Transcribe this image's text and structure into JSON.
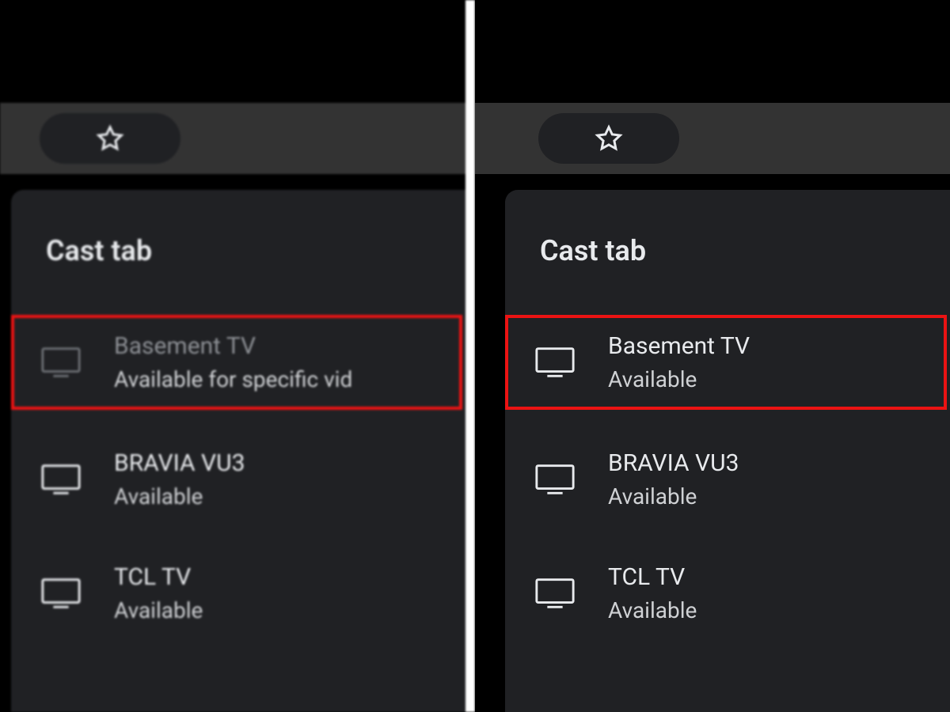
{
  "left": {
    "title": "Cast tab",
    "devices": [
      {
        "name": "Basement TV",
        "status": "Available for specific vid",
        "highlighted": true,
        "dimmed": true
      },
      {
        "name": "BRAVIA VU3",
        "status": "Available",
        "highlighted": false,
        "dimmed": false
      },
      {
        "name": "TCL TV",
        "status": "Available",
        "highlighted": false,
        "dimmed": false
      }
    ]
  },
  "right": {
    "title": "Cast tab",
    "devices": [
      {
        "name": "Basement TV",
        "status": "Available",
        "highlighted": true,
        "dimmed": false
      },
      {
        "name": "BRAVIA VU3",
        "status": "Available",
        "highlighted": false,
        "dimmed": false
      },
      {
        "name": "TCL TV",
        "status": "Available",
        "highlighted": false,
        "dimmed": false
      }
    ]
  }
}
